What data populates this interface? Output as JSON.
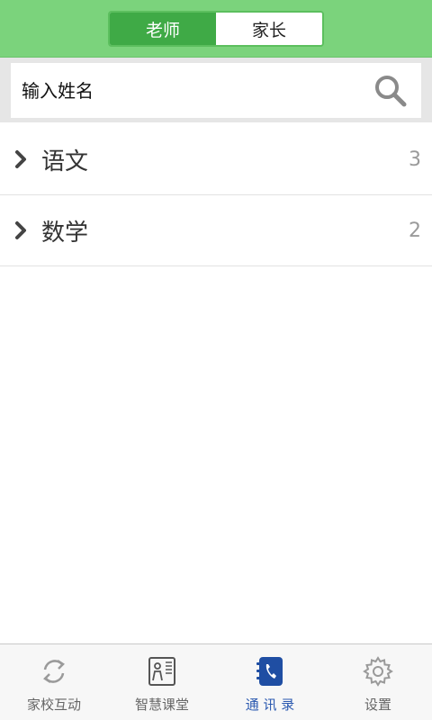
{
  "header": {
    "tabs": [
      {
        "label": "老师",
        "active": true
      },
      {
        "label": "家长",
        "active": false
      }
    ]
  },
  "search": {
    "placeholder": "输入姓名",
    "value": ""
  },
  "groups": [
    {
      "name": "语文",
      "count": "3"
    },
    {
      "name": "数学",
      "count": "2"
    }
  ],
  "tabbar": {
    "items": [
      {
        "label": "家校互动",
        "icon": "sync-icon",
        "active": false
      },
      {
        "label": "智慧课堂",
        "icon": "classroom-icon",
        "active": false
      },
      {
        "label": "通 讯 录",
        "icon": "phonebook-icon",
        "active": true
      },
      {
        "label": "设置",
        "icon": "gear-icon",
        "active": false
      }
    ]
  },
  "colors": {
    "header_bg": "#7bd37c",
    "segment_active": "#3faa46",
    "tab_active": "#2b59b0"
  }
}
